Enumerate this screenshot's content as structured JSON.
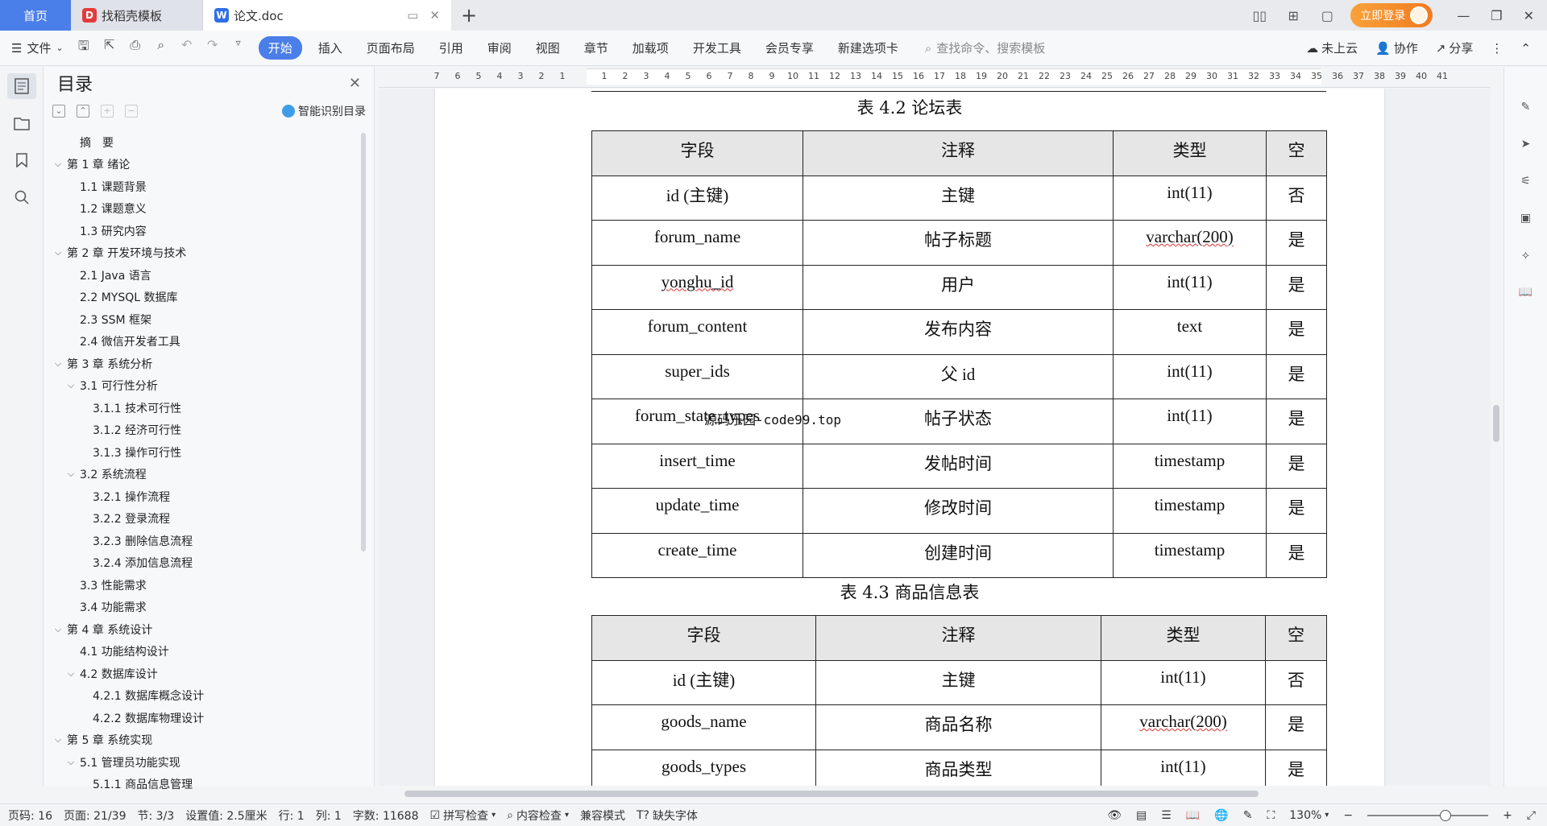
{
  "titlebar": {
    "tabs": [
      {
        "label": "首页"
      },
      {
        "label": "找稻壳模板"
      },
      {
        "label": "论文.doc"
      }
    ],
    "login_label": "立即登录"
  },
  "ribbon": {
    "file_label": "文件",
    "tabs": [
      "开始",
      "插入",
      "页面布局",
      "引用",
      "审阅",
      "视图",
      "章节",
      "加载项",
      "开发工具",
      "会员专享",
      "新建选项卡"
    ],
    "search_placeholder": "查找命令、搜索模板",
    "cloud_label": "未上云",
    "collab_label": "协作",
    "share_label": "分享"
  },
  "toc": {
    "title": "目录",
    "smart_label": "智能识别目录",
    "items": [
      {
        "label": "摘　要",
        "level": 0,
        "arrow": false
      },
      {
        "label": "第 1 章  绪论",
        "level": 0,
        "arrow": true
      },
      {
        "label": "1.1  课题背景",
        "level": 1,
        "arrow": false
      },
      {
        "label": "1.2  课题意义",
        "level": 1,
        "arrow": false
      },
      {
        "label": "1.3  研究内容",
        "level": 1,
        "arrow": false
      },
      {
        "label": "第 2 章  开发环境与技术",
        "level": 0,
        "arrow": true
      },
      {
        "label": "2.1 Java 语言",
        "level": 1,
        "arrow": false
      },
      {
        "label": "2.2 MYSQL 数据库",
        "level": 1,
        "arrow": false
      },
      {
        "label": "2.3 SSM 框架",
        "level": 1,
        "arrow": false
      },
      {
        "label": "2.4 微信开发者工具",
        "level": 1,
        "arrow": false
      },
      {
        "label": "第 3 章  系统分析",
        "level": 0,
        "arrow": true
      },
      {
        "label": "3.1  可行性分析",
        "level": 1,
        "arrow": true
      },
      {
        "label": "3.1.1  技术可行性",
        "level": 2,
        "arrow": false
      },
      {
        "label": "3.1.2  经济可行性",
        "level": 2,
        "arrow": false
      },
      {
        "label": "3.1.3  操作可行性",
        "level": 2,
        "arrow": false
      },
      {
        "label": "3.2  系统流程",
        "level": 1,
        "arrow": true
      },
      {
        "label": "3.2.1  操作流程",
        "level": 2,
        "arrow": false
      },
      {
        "label": "3.2.2  登录流程",
        "level": 2,
        "arrow": false
      },
      {
        "label": "3.2.3  删除信息流程",
        "level": 2,
        "arrow": false
      },
      {
        "label": "3.2.4  添加信息流程",
        "level": 2,
        "arrow": false
      },
      {
        "label": "3.3  性能需求",
        "level": 1,
        "arrow": false
      },
      {
        "label": "3.4  功能需求",
        "level": 1,
        "arrow": false
      },
      {
        "label": "第 4 章  系统设计",
        "level": 0,
        "arrow": true
      },
      {
        "label": "4.1  功能结构设计",
        "level": 1,
        "arrow": false
      },
      {
        "label": "4.2  数据库设计",
        "level": 1,
        "arrow": true
      },
      {
        "label": "4.2.1  数据库概念设计",
        "level": 2,
        "arrow": false
      },
      {
        "label": "4.2.2  数据库物理设计",
        "level": 2,
        "arrow": false
      },
      {
        "label": "第 5 章  系统实现",
        "level": 0,
        "arrow": true
      },
      {
        "label": "5.1  管理员功能实现",
        "level": 1,
        "arrow": true
      },
      {
        "label": "5.1.1  商品信息管理",
        "level": 2,
        "arrow": false
      }
    ]
  },
  "ruler": {
    "left_numbers": [
      "7",
      "6",
      "5",
      "4",
      "3",
      "2",
      "1"
    ],
    "right_numbers": [
      "1",
      "2",
      "3",
      "4",
      "5",
      "6",
      "7",
      "8",
      "9",
      "10",
      "11",
      "12",
      "13",
      "14",
      "15",
      "16",
      "17",
      "18",
      "19",
      "20",
      "21",
      "22",
      "23",
      "24",
      "25",
      "26",
      "27",
      "28",
      "29",
      "30",
      "31",
      "32",
      "33",
      "34",
      "35",
      "36",
      "37",
      "38",
      "39",
      "40",
      "41"
    ]
  },
  "document": {
    "table1": {
      "caption": "表 4.2  论坛表",
      "headers": [
        "字段",
        "注释",
        "类型",
        "空"
      ],
      "rows": [
        [
          "id (主键)",
          "主键",
          "int(11)",
          "否"
        ],
        [
          "forum_name",
          "帖子标题",
          "varchar(200)",
          "是"
        ],
        [
          "yonghu_id",
          "用户",
          "int(11)",
          "是"
        ],
        [
          "forum_content",
          "发布内容",
          "text",
          "是"
        ],
        [
          "super_ids",
          "父 id",
          "int(11)",
          "是"
        ],
        [
          "forum_state_types",
          "帖子状态",
          "int(11)",
          "是"
        ],
        [
          "insert_time",
          "发帖时间",
          "timestamp",
          "是"
        ],
        [
          "update_time",
          "修改时间",
          "timestamp",
          "是"
        ],
        [
          "create_time",
          "创建时间",
          "timestamp",
          "是"
        ]
      ]
    },
    "table2": {
      "caption": "表 4.3  商品信息表",
      "headers": [
        "字段",
        "注释",
        "类型",
        "空"
      ],
      "rows": [
        [
          "id (主键)",
          "主键",
          "int(11)",
          "否"
        ],
        [
          "goods_name",
          "商品名称",
          "varchar(200)",
          "是"
        ],
        [
          "goods_types",
          "商品类型",
          "int(11)",
          "是"
        ]
      ]
    },
    "watermark": "源码乐园-code99.top"
  },
  "status": {
    "page_code": "页码: 16",
    "page": "页面: 21/39",
    "section": "节: 3/3",
    "setting": "设置值: 2.5厘米",
    "row": "行: 1",
    "col": "列: 1",
    "words": "字数: 11688",
    "spell": "拼写检查",
    "content_check": "内容检查",
    "compat": "兼容模式",
    "missing_font": "缺失字体",
    "zoom": "130%"
  }
}
